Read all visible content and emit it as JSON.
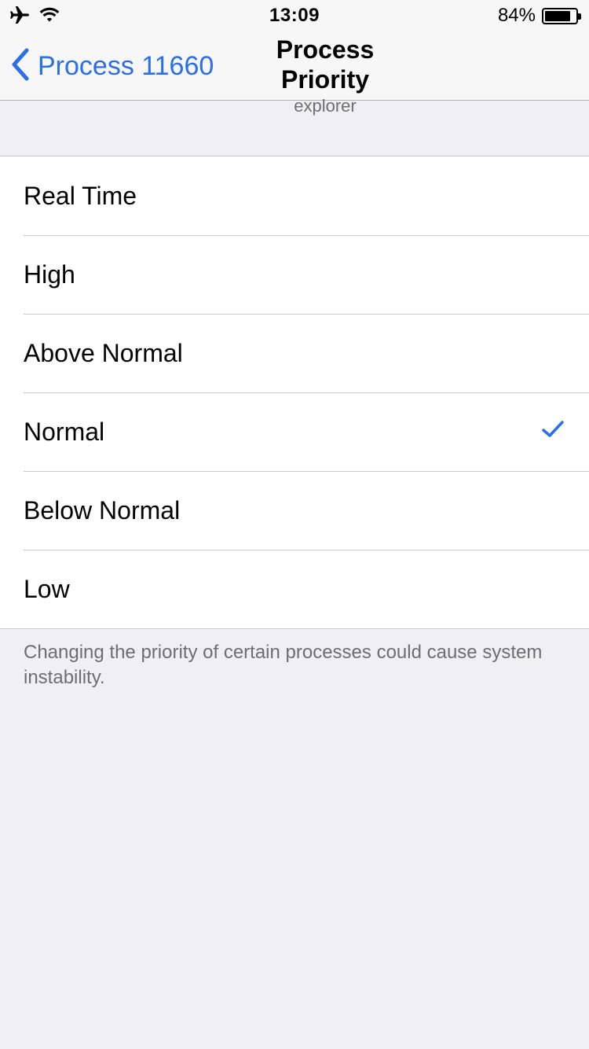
{
  "status_bar": {
    "time": "13:09",
    "battery": "84%",
    "battery_level": 0.84,
    "icons": [
      "airplane-icon",
      "wifi-icon",
      "battery-icon"
    ]
  },
  "nav": {
    "back_label": "Process 11660",
    "title": "Process Priority",
    "subtitle": "explorer"
  },
  "priorities": [
    {
      "label": "Real Time",
      "selected": false
    },
    {
      "label": "High",
      "selected": false
    },
    {
      "label": "Above Normal",
      "selected": false
    },
    {
      "label": "Normal",
      "selected": true
    },
    {
      "label": "Below Normal",
      "selected": false
    },
    {
      "label": "Low",
      "selected": false
    }
  ],
  "footer": {
    "note": "Changing the priority of certain processes could cause system instability."
  },
  "colors": {
    "accent": "#2a6ee8",
    "background": "#efeff4",
    "secondary_text": "#6d6d72"
  }
}
